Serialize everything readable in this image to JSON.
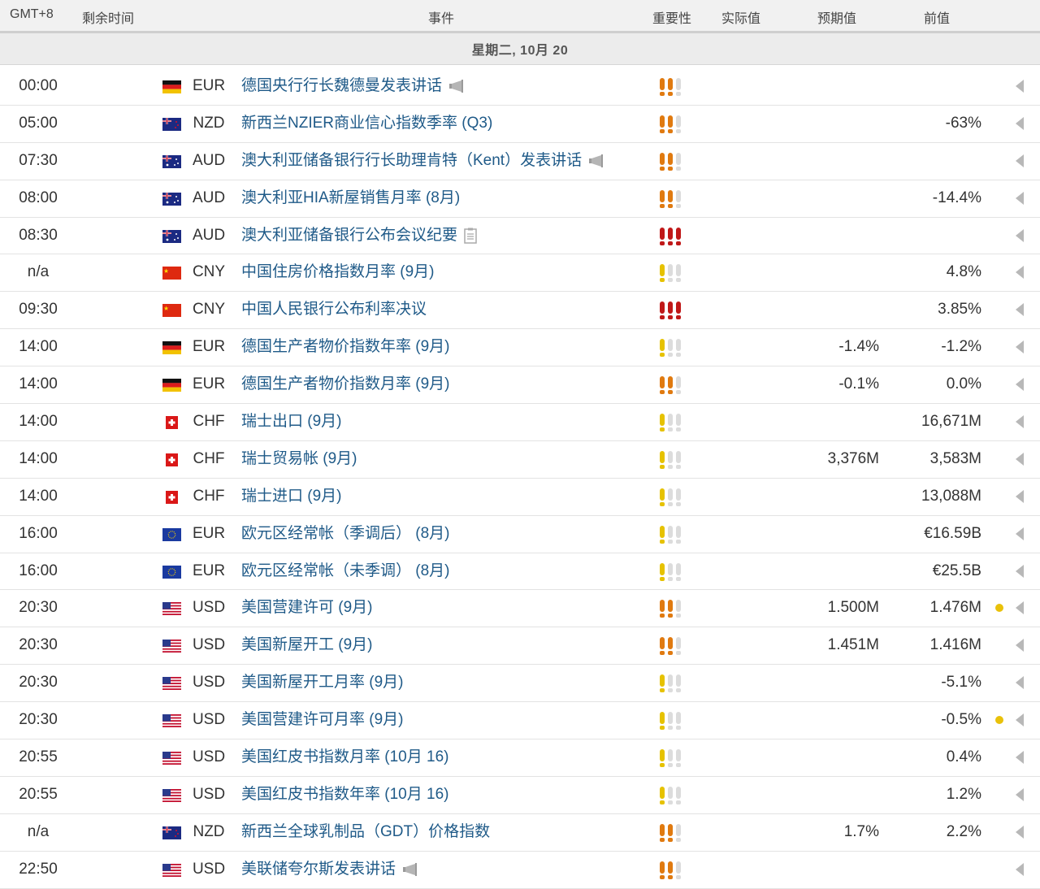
{
  "header": {
    "tz": "GMT+8",
    "remaining": "剩余时间",
    "event": "事件",
    "importance": "重要性",
    "actual": "实际值",
    "forecast": "预期值",
    "previous": "前值"
  },
  "day_label": "星期二, 10月 20",
  "colors": {
    "low": "#e6c200",
    "medium": "#e07a10",
    "high": "#c01818",
    "inactive": "#dcdcdc",
    "link": "#1f5a88",
    "dot": "#e9c10a"
  },
  "rows": [
    {
      "time": "00:00",
      "flag": "de",
      "cur": "EUR",
      "event": "德国央行行长魏德曼发表讲话",
      "icon": "speech-icon",
      "imp": 2,
      "actual": "",
      "forecast": "",
      "previous": "",
      "dot": false
    },
    {
      "time": "05:00",
      "flag": "nz",
      "cur": "NZD",
      "event": "新西兰NZIER商业信心指数季率 (Q3)",
      "icon": "",
      "imp": 2,
      "actual": "",
      "forecast": "",
      "previous": "-63%",
      "dot": false
    },
    {
      "time": "07:30",
      "flag": "au",
      "cur": "AUD",
      "event": "澳大利亚储备银行行长助理肯特（Kent）发表讲话",
      "icon": "speech-icon",
      "imp": 2,
      "actual": "",
      "forecast": "",
      "previous": "",
      "dot": false
    },
    {
      "time": "08:00",
      "flag": "au",
      "cur": "AUD",
      "event": "澳大利亚HIA新屋销售月率 (8月)",
      "icon": "",
      "imp": 2,
      "actual": "",
      "forecast": "",
      "previous": "-14.4%",
      "dot": false
    },
    {
      "time": "08:30",
      "flag": "au",
      "cur": "AUD",
      "event": "澳大利亚储备银行公布会议纪要",
      "icon": "document-icon",
      "imp": 3,
      "actual": "",
      "forecast": "",
      "previous": "",
      "dot": false
    },
    {
      "time": "n/a",
      "flag": "cn",
      "cur": "CNY",
      "event": "中国住房价格指数月率 (9月)",
      "icon": "",
      "imp": 1,
      "actual": "",
      "forecast": "",
      "previous": "4.8%",
      "dot": false
    },
    {
      "time": "09:30",
      "flag": "cn",
      "cur": "CNY",
      "event": "中国人民银行公布利率决议",
      "icon": "",
      "imp": 3,
      "actual": "",
      "forecast": "",
      "previous": "3.85%",
      "dot": false
    },
    {
      "time": "14:00",
      "flag": "de",
      "cur": "EUR",
      "event": "德国生产者物价指数年率 (9月)",
      "icon": "",
      "imp": 1,
      "actual": "",
      "forecast": "-1.4%",
      "previous": "-1.2%",
      "dot": false
    },
    {
      "time": "14:00",
      "flag": "de",
      "cur": "EUR",
      "event": "德国生产者物价指数月率 (9月)",
      "icon": "",
      "imp": 2,
      "actual": "",
      "forecast": "-0.1%",
      "previous": "0.0%",
      "dot": false
    },
    {
      "time": "14:00",
      "flag": "ch",
      "cur": "CHF",
      "event": "瑞士出口 (9月)",
      "icon": "",
      "imp": 1,
      "actual": "",
      "forecast": "",
      "previous": "16,671M",
      "dot": false
    },
    {
      "time": "14:00",
      "flag": "ch",
      "cur": "CHF",
      "event": "瑞士贸易帐 (9月)",
      "icon": "",
      "imp": 1,
      "actual": "",
      "forecast": "3,376M",
      "previous": "3,583M",
      "dot": false
    },
    {
      "time": "14:00",
      "flag": "ch",
      "cur": "CHF",
      "event": "瑞士进口 (9月)",
      "icon": "",
      "imp": 1,
      "actual": "",
      "forecast": "",
      "previous": "13,088M",
      "dot": false
    },
    {
      "time": "16:00",
      "flag": "eu",
      "cur": "EUR",
      "event": "欧元区经常帐（季调后） (8月)",
      "icon": "",
      "imp": 1,
      "actual": "",
      "forecast": "",
      "previous": "€16.59B",
      "dot": false
    },
    {
      "time": "16:00",
      "flag": "eu",
      "cur": "EUR",
      "event": "欧元区经常帐（未季调） (8月)",
      "icon": "",
      "imp": 1,
      "actual": "",
      "forecast": "",
      "previous": "€25.5B",
      "dot": false
    },
    {
      "time": "20:30",
      "flag": "us",
      "cur": "USD",
      "event": "美国营建许可 (9月)",
      "icon": "",
      "imp": 2,
      "actual": "",
      "forecast": "1.500M",
      "previous": "1.476M",
      "dot": true
    },
    {
      "time": "20:30",
      "flag": "us",
      "cur": "USD",
      "event": "美国新屋开工 (9月)",
      "icon": "",
      "imp": 2,
      "actual": "",
      "forecast": "1.451M",
      "previous": "1.416M",
      "dot": false
    },
    {
      "time": "20:30",
      "flag": "us",
      "cur": "USD",
      "event": "美国新屋开工月率 (9月)",
      "icon": "",
      "imp": 1,
      "actual": "",
      "forecast": "",
      "previous": "-5.1%",
      "dot": false
    },
    {
      "time": "20:30",
      "flag": "us",
      "cur": "USD",
      "event": "美国营建许可月率 (9月)",
      "icon": "",
      "imp": 1,
      "actual": "",
      "forecast": "",
      "previous": "-0.5%",
      "dot": true
    },
    {
      "time": "20:55",
      "flag": "us",
      "cur": "USD",
      "event": "美国红皮书指数月率 (10月 16)",
      "icon": "",
      "imp": 1,
      "actual": "",
      "forecast": "",
      "previous": "0.4%",
      "dot": false
    },
    {
      "time": "20:55",
      "flag": "us",
      "cur": "USD",
      "event": "美国红皮书指数年率 (10月 16)",
      "icon": "",
      "imp": 1,
      "actual": "",
      "forecast": "",
      "previous": "1.2%",
      "dot": false
    },
    {
      "time": "n/a",
      "flag": "nz",
      "cur": "NZD",
      "event": "新西兰全球乳制品（GDT）价格指数",
      "icon": "",
      "imp": 2,
      "actual": "",
      "forecast": "1.7%",
      "previous": "2.2%",
      "dot": false
    },
    {
      "time": "22:50",
      "flag": "us",
      "cur": "USD",
      "event": "美联储夸尔斯发表讲话",
      "icon": "speech-icon",
      "imp": 2,
      "actual": "",
      "forecast": "",
      "previous": "",
      "dot": false
    }
  ]
}
